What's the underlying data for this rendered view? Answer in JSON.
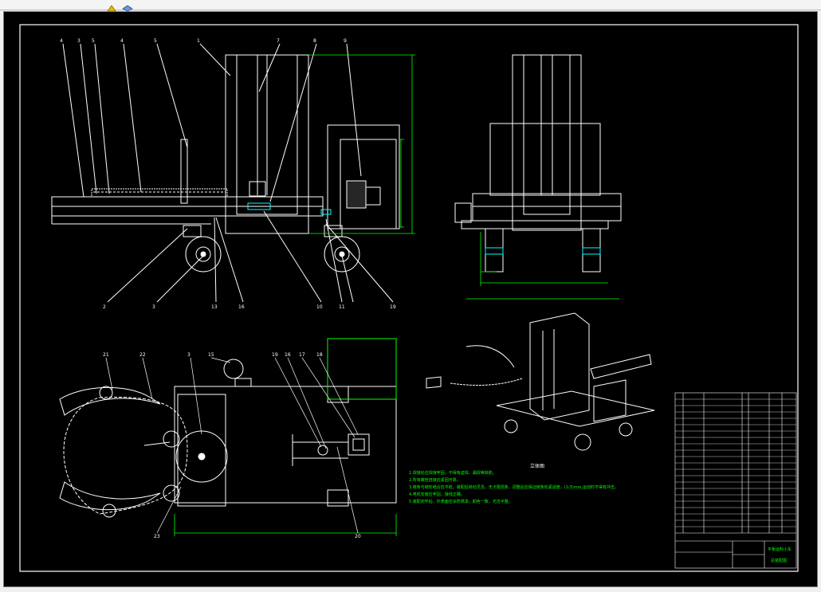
{
  "toolbar": {
    "icons": [
      "hand-icon",
      "layer-icon"
    ]
  },
  "views": {
    "side_balloons_top": [
      "4",
      "3",
      "5",
      "4",
      "5",
      "1",
      "7",
      "8",
      "9"
    ],
    "side_balloons_bottom": [
      "2",
      "3",
      "13",
      "16",
      "10",
      "11",
      "19"
    ],
    "top_balloons_top": [
      "21",
      "22",
      "3",
      "15",
      "19",
      "16",
      "17",
      "18"
    ],
    "top_balloons_bottom": [
      "23",
      "20"
    ],
    "iso_label": "立体图"
  },
  "notes": [
    "1.焊接处应焊接牢固，不得有虚焊、漏焊等缺陷。",
    "2.所有螺栓连接应紧固可靠。",
    "3.链条与链轮啮合应平稳，装配后转动灵活，无卡阻现象，调整后应保证链条松紧适度，(1/3)mm,运动时不得有冲击。",
    "4.电机安装应牢固，接线正确。",
    "5.装配完毕后，外表面应涂防锈漆，颜色一致，光洁平整。"
  ],
  "title_block": {
    "title": "平板运料小车",
    "drawing_no": "总装配图"
  },
  "colors": {
    "background": "#000000",
    "line": "#ffffff",
    "dimension": "#00ff00",
    "highlight": "#00ffff",
    "frame": "#ffffff"
  }
}
